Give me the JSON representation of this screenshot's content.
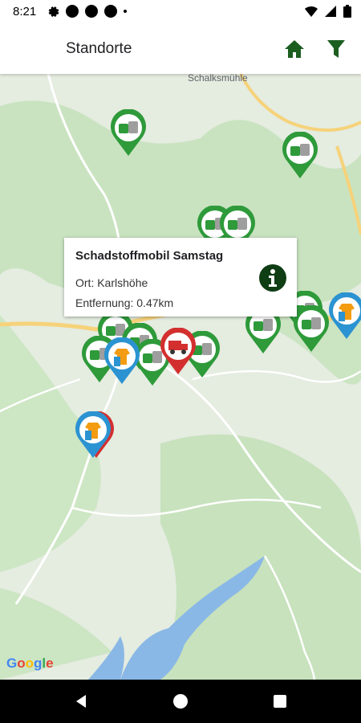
{
  "status": {
    "time": "8:21"
  },
  "appbar": {
    "title": "Standorte",
    "home_icon": "home-icon",
    "filter_icon": "filter-icon"
  },
  "map": {
    "place_label": "Schalksmühle",
    "attribution": "Google",
    "colors": {
      "green": "#2e9a3a",
      "blue": "#2b93d1",
      "red": "#d32f2f",
      "water": "#5fa2de"
    }
  },
  "info": {
    "title": "Schadstoffmobil Samstag",
    "location": "Ort: Karlshöhe",
    "distance": "Entfernung: 0.47km",
    "icon": "info-icon"
  }
}
